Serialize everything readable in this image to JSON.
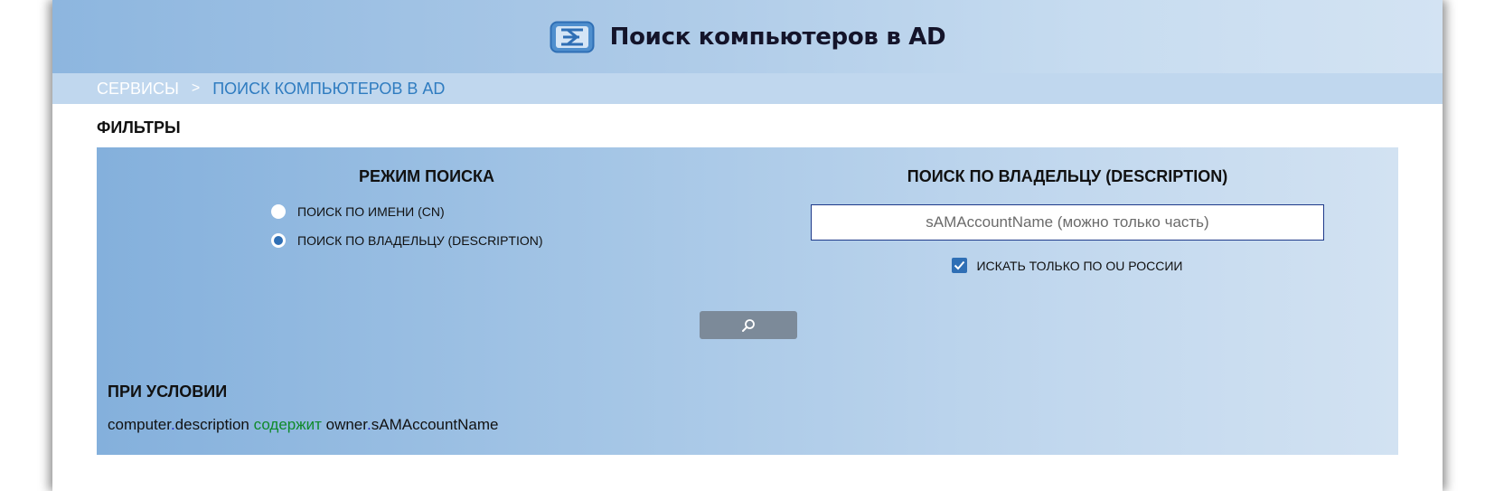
{
  "header": {
    "title": "Поиск компьютеров в AD",
    "logo_icon": "app-logo-icon"
  },
  "breadcrumb": {
    "root": "СЕРВИСЫ",
    "separator": ">",
    "current": "ПОИСК КОМПЬЮТЕРОВ В AD"
  },
  "filters": {
    "title": "ФИЛЬТРЫ",
    "search_mode": {
      "title": "РЕЖИМ ПОИСКА",
      "options": [
        {
          "label": "ПОИСК ПО ИМЕНИ (CN)",
          "selected": false
        },
        {
          "label": "ПОИСК ПО ВЛАДЕЛЬЦУ (DESCRIPTION)",
          "selected": true
        }
      ]
    },
    "owner_search": {
      "title": "ПОИСК ПО ВЛАДЕЛЬЦУ (DESCRIPTION)",
      "input_value": "",
      "input_placeholder": "sAMAccountName (можно только часть)",
      "russia_only_label": "ИСКАТЬ ТОЛЬКО ПО OU РОССИИ",
      "russia_only_checked": true
    },
    "search_button_icon": "search-icon",
    "condition": {
      "title": "ПРИ УСЛОВИИ",
      "left_object": "computer",
      "left_field": "description",
      "dot": ".",
      "operator": "содержит",
      "right_object": "owner",
      "right_field": "sAMAccountName"
    }
  },
  "colors": {
    "accent": "#2f6fb5",
    "breadcrumb_link": "#2f7cc0",
    "operator": "#0f8a2a",
    "search_button": "#7c8a99"
  }
}
